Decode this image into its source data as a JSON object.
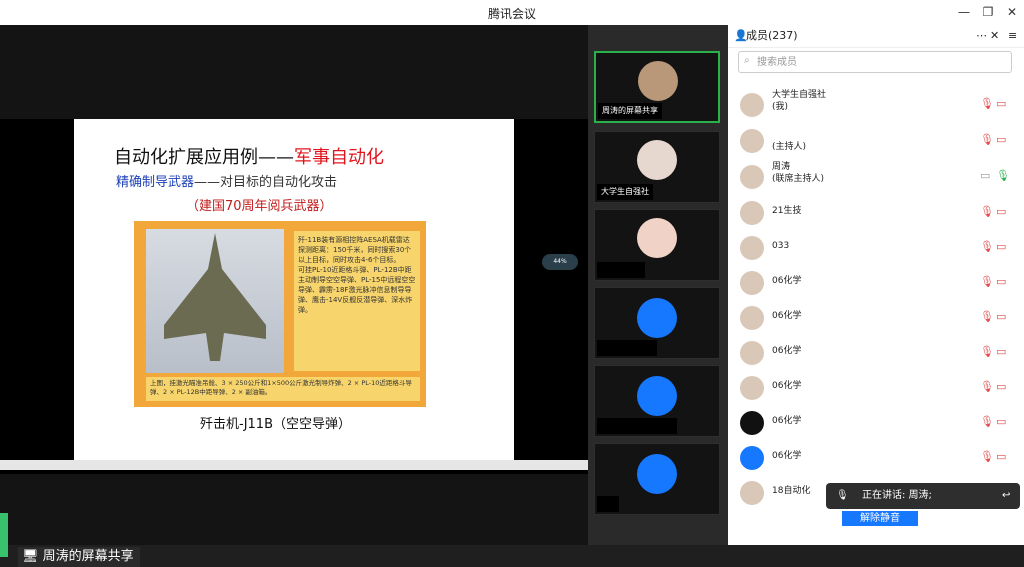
{
  "window": {
    "title": "腾讯会议"
  },
  "slide": {
    "title_a": "自动化扩展应用例——",
    "title_b": "军事自动化",
    "subtitle_a": "精确制导武器",
    "subtitle_b": "——对目标的自动化攻击",
    "red_note": "（建国70周年阅兵武器）",
    "caption": "歼击机-J11B（空空导弹）",
    "box_text": "歼-11B装有源相控阵AESA机载雷达\n探测距离：150千米，同时搜索30个以上目标，同时攻击4-6个目标。\n可挂PL-10近距格斗弹、PL-12B中距主动制导空空导弹、PL-15中远程空空导弹、霹雳-18F激光脉冲信息制导导弹、鹰击-14V反舰反潜导弹、深水炸弹。",
    "bottom_text": "上图，挂激光瞄准吊舱、3 × 250公斤和1×500公斤激光制导炸弹、2 × PL-10近距格斗导弹、2 × PL-12B中距导弹、2 × 副油箱。"
  },
  "badge": {
    "value": "44%"
  },
  "share_label": "周涛的屏幕共享",
  "video_tiles": [
    {
      "label": "周涛的屏幕共享"
    },
    {
      "label": "大学生自强社"
    },
    {
      "label": ""
    },
    {
      "label": ""
    },
    {
      "label": ""
    },
    {
      "label": ""
    }
  ],
  "members": {
    "header": "成员(237)",
    "search_placeholder": "搜索成员",
    "list": [
      {
        "name": "大学生自强社",
        "sub": "(我)"
      },
      {
        "name": "",
        "sub": "(主持人)"
      },
      {
        "name": "周涛",
        "sub": "(联席主持人)"
      },
      {
        "name": "21生技",
        "sub": ""
      },
      {
        "name": "033",
        "sub": ""
      },
      {
        "name": "06化学",
        "sub": ""
      },
      {
        "name": "06化学",
        "sub": ""
      },
      {
        "name": "06化学",
        "sub": ""
      },
      {
        "name": "06化学",
        "sub": ""
      },
      {
        "name": "06化学",
        "sub": ""
      },
      {
        "name": "06化学",
        "sub": ""
      },
      {
        "name": "18自动化",
        "sub": ""
      }
    ]
  },
  "speaking": {
    "text": "正在讲话: 周涛;"
  },
  "unmute": {
    "label": "解除静音"
  }
}
